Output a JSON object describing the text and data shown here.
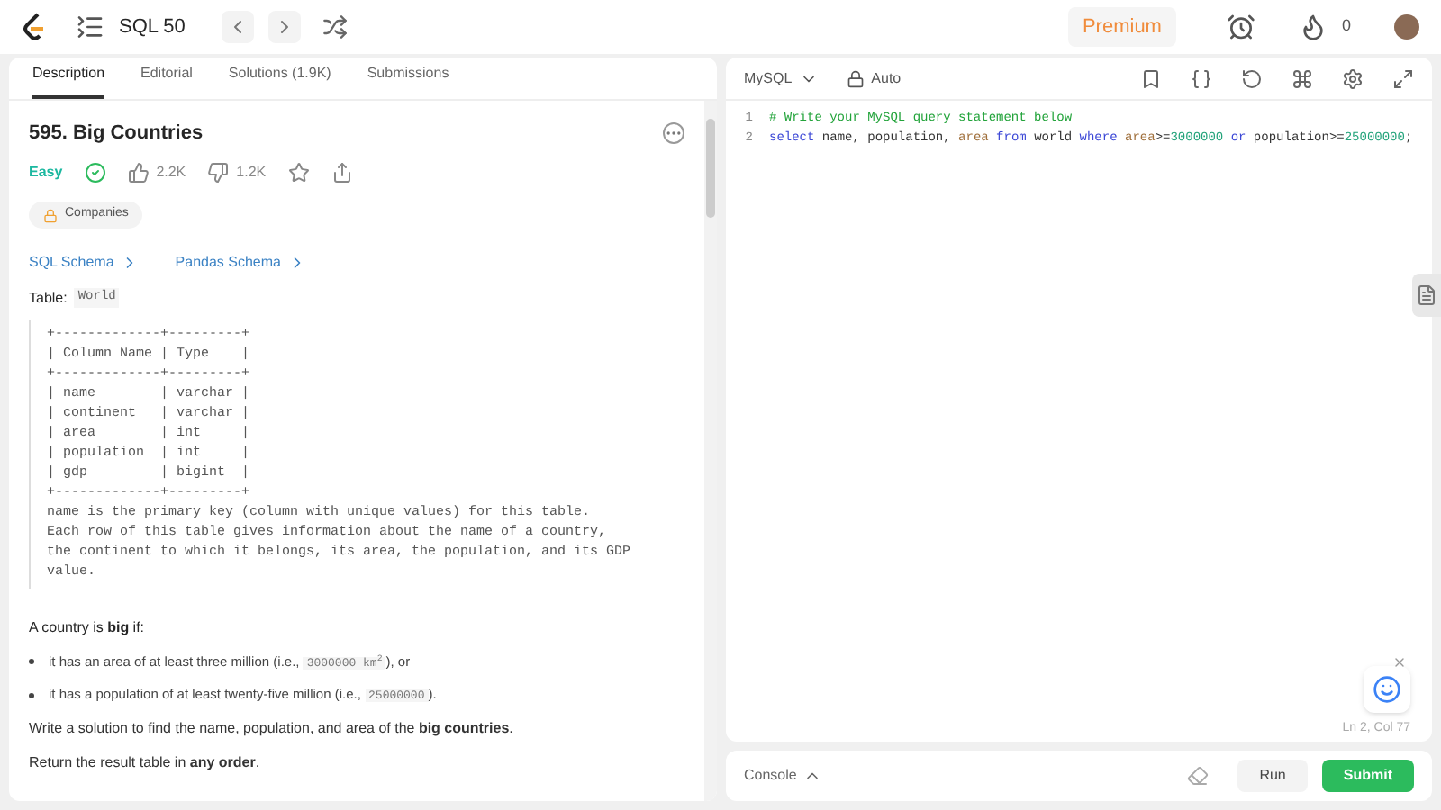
{
  "nav": {
    "title": "SQL 50",
    "premium": "Premium",
    "streak": "0"
  },
  "tabs": [
    {
      "label": "Description",
      "selected": true
    },
    {
      "label": "Editorial",
      "selected": false
    },
    {
      "label": "Solutions (1.9K)",
      "selected": false
    },
    {
      "label": "Submissions",
      "selected": false
    }
  ],
  "problem": {
    "title": "595. Big Countries",
    "difficulty": "Easy",
    "solved": true,
    "likes": "2.2K",
    "dislikes": "1.2K",
    "tag": "Companies",
    "links": [
      "SQL Schema",
      "Pandas Schema"
    ],
    "table_label": "Table:",
    "table_name": "World",
    "schema": "+-------------+---------+\n| Column Name | Type    |\n+-------------+---------+\n| name        | varchar |\n| continent   | varchar |\n| area        | int     |\n| population  | int     |\n| gdp         | bigint  |\n+-------------+---------+\nname is the primary key (column with unique values) for this table.\nEach row of this table gives information about the name of a country,\nthe continent to which it belongs, its area, the population, and its GDP\nvalue.",
    "intro": "A country is **big** if:",
    "bullets": [
      [
        {
          "kind": "text",
          "text": "it has an area of at least three million (i.e., "
        },
        {
          "kind": "code",
          "text": "3000000 km$^{2}$"
        },
        {
          "kind": "text",
          "text": "), or"
        }
      ],
      [
        {
          "kind": "text",
          "text": "it has a population of at least twenty-five million (i.e., "
        },
        {
          "kind": "code",
          "text": "25000000"
        },
        {
          "kind": "text",
          "text": ")."
        }
      ]
    ],
    "paragraphs": [
      "Write a solution to find the name, population, and area of the **big countries**.",
      "Return the result table in **any order**."
    ]
  },
  "editor": {
    "language": "MySQL",
    "mode": "Auto",
    "status": "Ln 2, Col 77",
    "lines": [
      {
        "number": "1",
        "tokens": [
          {
            "kind": "comment",
            "text": "# Write your MySQL query statement below"
          }
        ]
      },
      {
        "number": "2",
        "tokens": [
          {
            "kind": "keyword",
            "text": "select"
          },
          {
            "kind": "plain",
            "text": " name, population, "
          },
          {
            "kind": "ident",
            "text": "area"
          },
          {
            "kind": "keyword",
            "text": " from"
          },
          {
            "kind": "plain",
            "text": " world "
          },
          {
            "kind": "keyword",
            "text": "where"
          },
          {
            "kind": "ident",
            "text": " area"
          },
          {
            "kind": "plain",
            "text": ">="
          },
          {
            "kind": "number",
            "text": "3000000"
          },
          {
            "kind": "keyword",
            "text": " or"
          },
          {
            "kind": "plain",
            "text": " population>="
          },
          {
            "kind": "number",
            "text": "25000000"
          },
          {
            "kind": "plain",
            "text": ";"
          }
        ]
      }
    ]
  },
  "console": {
    "label": "Console",
    "run": "Run",
    "submit": "Submit"
  }
}
